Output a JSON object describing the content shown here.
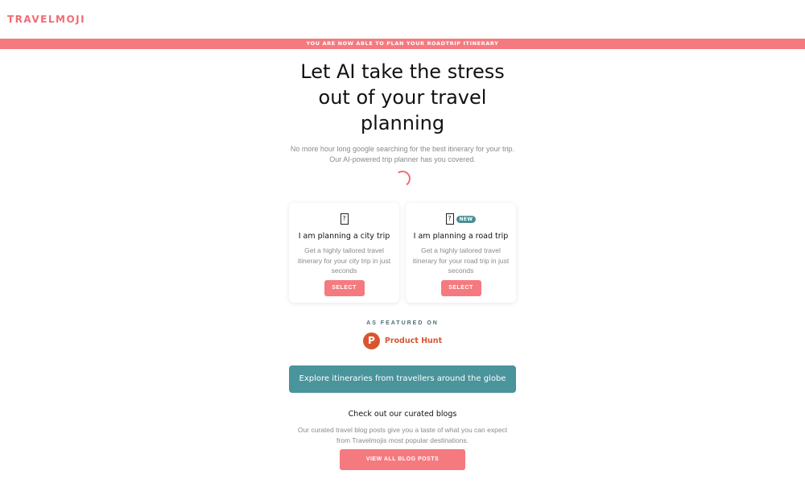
{
  "header": {
    "logo": "TRAVELMOJI"
  },
  "announcement": "YOU ARE NOW ABLE TO PLAN YOUR ROADTRIP ITINERARY",
  "hero": {
    "title_lines": [
      "Let AI take the stress",
      "out of your travel",
      "planning"
    ],
    "subtitle_lines": [
      "No more hour long google searching for the best itinerary for your trip.",
      "Our AI-powered trip planner has you covered."
    ]
  },
  "cards": [
    {
      "icon": "?",
      "badge": "",
      "title": "I am planning a city trip",
      "description": "Get a highly tailored travel itinerary for your city trip in just seconds",
      "button": "SELECT"
    },
    {
      "icon": "?",
      "badge": "NEW",
      "title": "I am planning a road trip",
      "description": "Get a highly tailored travel itinerary for your road trip in just seconds",
      "button": "SELECT"
    }
  ],
  "featured": {
    "label": "AS FEATURED ON",
    "logo_letter": "P",
    "name": "Product Hunt"
  },
  "explore_button": "Explore itineraries from travellers around the globe",
  "blogs": {
    "title": "Check out our curated blogs",
    "description_lines": [
      "Our curated travel blog posts give you a taste of what you can expect",
      "from Travelmojis most popular destinations."
    ],
    "button": "VIEW ALL BLOG POSTS"
  },
  "colors": {
    "brand": "#f26b73",
    "accent_teal": "#4a949c",
    "product_hunt": "#da552f"
  }
}
